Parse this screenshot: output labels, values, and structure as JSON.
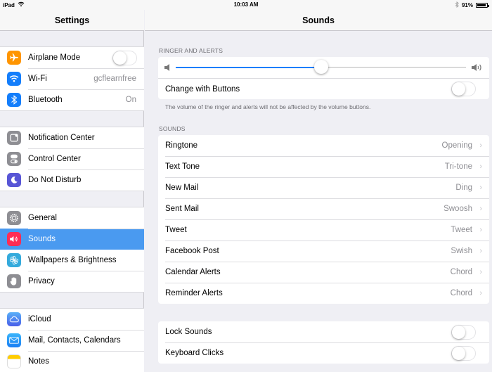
{
  "status_bar": {
    "device": "iPad",
    "time": "10:03 AM",
    "battery_percent": "91%",
    "battery_level": 0.91
  },
  "sidebar": {
    "title": "Settings",
    "groups": [
      {
        "items": [
          {
            "label": "Airplane Mode",
            "icon": "airplane-icon",
            "color": "#ff9500",
            "toggle": false
          },
          {
            "label": "Wi-Fi",
            "icon": "wifi-icon",
            "color": "#147efb",
            "value": "gcflearnfree"
          },
          {
            "label": "Bluetooth",
            "icon": "bluetooth-icon",
            "color": "#147efb",
            "value": "On"
          }
        ]
      },
      {
        "items": [
          {
            "label": "Notification Center",
            "icon": "notification-center-icon",
            "color": "#8e8e93"
          },
          {
            "label": "Control Center",
            "icon": "control-center-icon",
            "color": "#8e8e93"
          },
          {
            "label": "Do Not Disturb",
            "icon": "moon-icon",
            "color": "#5856d6"
          }
        ]
      },
      {
        "items": [
          {
            "label": "General",
            "icon": "gear-icon",
            "color": "#8e8e93"
          },
          {
            "label": "Sounds",
            "icon": "speaker-icon",
            "color": "#ff2d55",
            "selected": true
          },
          {
            "label": "Wallpapers & Brightness",
            "icon": "flower-icon",
            "color": "#34aadc"
          },
          {
            "label": "Privacy",
            "icon": "hand-icon",
            "color": "#8e8e93"
          }
        ]
      },
      {
        "items": [
          {
            "label": "iCloud",
            "icon": "cloud-icon",
            "color": "#4a7ff0"
          },
          {
            "label": "Mail, Contacts, Calendars",
            "icon": "mail-icon",
            "color": "#1d9bf6"
          },
          {
            "label": "Notes",
            "icon": "notes-icon",
            "color": "#ffcc00"
          }
        ]
      }
    ]
  },
  "main": {
    "title": "Sounds",
    "ringer": {
      "header": "RINGER AND ALERTS",
      "volume_level": 0.5,
      "change_with_buttons_label": "Change with Buttons",
      "change_with_buttons": false,
      "note": "The volume of the ringer and alerts will not be affected by the volume buttons."
    },
    "sounds": {
      "header": "SOUNDS",
      "items": [
        {
          "label": "Ringtone",
          "value": "Opening"
        },
        {
          "label": "Text Tone",
          "value": "Tri-tone"
        },
        {
          "label": "New Mail",
          "value": "Ding"
        },
        {
          "label": "Sent Mail",
          "value": "Swoosh"
        },
        {
          "label": "Tweet",
          "value": "Tweet"
        },
        {
          "label": "Facebook Post",
          "value": "Swish"
        },
        {
          "label": "Calendar Alerts",
          "value": "Chord"
        },
        {
          "label": "Reminder Alerts",
          "value": "Chord"
        }
      ]
    },
    "other": {
      "items": [
        {
          "label": "Lock Sounds",
          "toggle": false
        },
        {
          "label": "Keyboard Clicks",
          "toggle": false
        }
      ]
    },
    "chevron": "›"
  },
  "colors": {
    "accent": "#147efb",
    "selected_row": "#4a9af0"
  }
}
